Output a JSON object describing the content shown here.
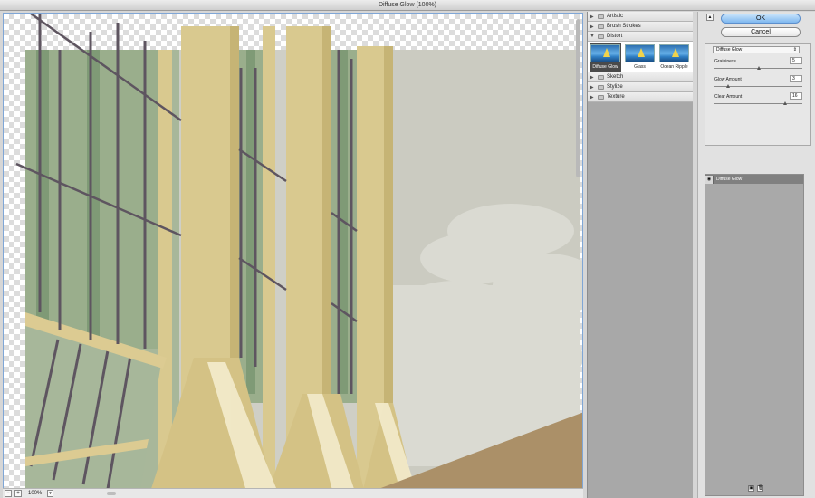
{
  "window": {
    "title": "Diffuse Glow (100%)"
  },
  "preview": {
    "zoom_level": "100%",
    "zoom_out_label": "−",
    "zoom_in_label": "+",
    "zoom_dropdown": "▾"
  },
  "filter_categories": [
    {
      "label": "Artistic",
      "expanded": false,
      "arrow": "▶"
    },
    {
      "label": "Brush Strokes",
      "expanded": false,
      "arrow": "▶"
    },
    {
      "label": "Distort",
      "expanded": true,
      "arrow": "▼"
    },
    {
      "label": "Sketch",
      "expanded": false,
      "arrow": "▶"
    },
    {
      "label": "Stylize",
      "expanded": false,
      "arrow": "▶"
    },
    {
      "label": "Texture",
      "expanded": false,
      "arrow": "▶"
    }
  ],
  "distort_filters": [
    {
      "label": "Diffuse Glow",
      "selected": true
    },
    {
      "label": "Glass",
      "selected": false
    },
    {
      "label": "Ocean Ripple",
      "selected": false
    }
  ],
  "panel": {
    "collapse_icon": "▲",
    "ok_label": "OK",
    "cancel_label": "Cancel",
    "filter_select": "Diffuse Glow",
    "select_arrow": "⇕",
    "params": [
      {
        "label": "Graininess",
        "value": "5",
        "fraction": 0.5
      },
      {
        "label": "Glow Amount",
        "value": "3",
        "fraction": 0.15
      },
      {
        "label": "Clear Amount",
        "value": "16",
        "fraction": 0.8
      }
    ]
  },
  "layers": [
    {
      "name": "Diffuse Glow",
      "eye": "◉"
    }
  ],
  "layer_footer": {
    "new_icon": "▣",
    "delete_icon": "🗑"
  },
  "colors": {
    "accent": "#7fb8ef",
    "preview_border": "#7fa6d6"
  }
}
